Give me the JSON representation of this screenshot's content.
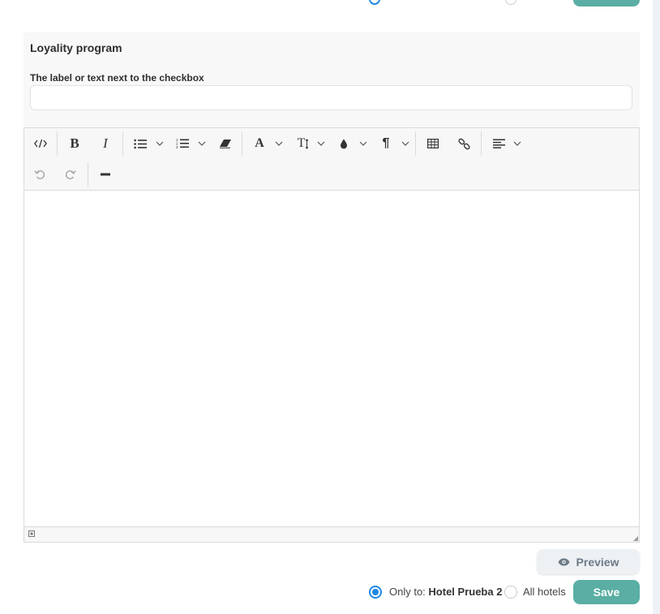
{
  "section": {
    "title": "Loyality program",
    "field_label": "The label or text next to the checkbox",
    "field_value": "",
    "field_placeholder": ""
  },
  "toolbar": {
    "row1": [
      {
        "name": "code-view-button",
        "icon": "code-icon"
      },
      {
        "name": "bold-button",
        "icon": "bold-icon",
        "glyph": "B"
      },
      {
        "name": "italic-button",
        "icon": "italic-icon",
        "glyph": "I"
      },
      {
        "name": "unordered-list-button",
        "icon": "bullet-list-icon"
      },
      {
        "name": "ordered-list-button",
        "icon": "numbered-list-icon"
      },
      {
        "name": "clear-format-button",
        "icon": "eraser-icon"
      },
      {
        "name": "font-color-button",
        "icon": "font-icon",
        "glyph": "A"
      },
      {
        "name": "font-size-button",
        "icon": "text-size-icon",
        "glyph": "T"
      },
      {
        "name": "background-color-button",
        "icon": "droplet-icon"
      },
      {
        "name": "paragraph-button",
        "icon": "paragraph-icon",
        "glyph": "¶"
      },
      {
        "name": "table-button",
        "icon": "table-icon"
      },
      {
        "name": "link-button",
        "icon": "link-icon"
      },
      {
        "name": "align-button",
        "icon": "align-left-icon"
      }
    ],
    "row2": [
      {
        "name": "undo-button",
        "icon": "undo-icon"
      },
      {
        "name": "redo-button",
        "icon": "redo-icon"
      },
      {
        "name": "horizontal-rule-button",
        "icon": "horizontal-rule-icon"
      }
    ]
  },
  "editor": {
    "content": ""
  },
  "actions": {
    "preview_label": "Preview",
    "only_to_prefix": "Only to:",
    "hotel_name": "Hotel Prueba 2",
    "all_hotels_label": "All hotels",
    "save_label": "Save",
    "selected_scope": "only"
  },
  "colors": {
    "accent": "#5aaea3",
    "radio": "#1e88e5",
    "panel_bg": "#f8f8f8",
    "preview_text": "#6c7a86"
  }
}
